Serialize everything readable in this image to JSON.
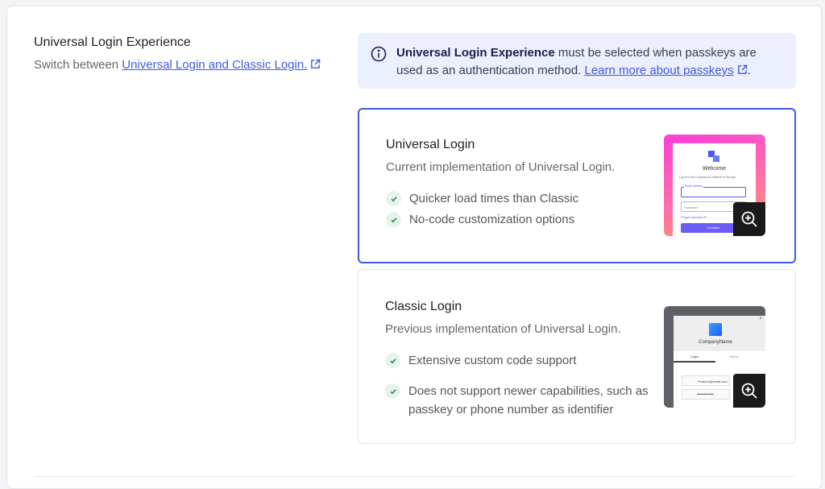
{
  "section": {
    "title": "Universal Login Experience",
    "description_prefix": "Switch between ",
    "description_link": "Universal Login and Classic Login."
  },
  "info": {
    "bold": "Universal Login Experience",
    "text": " must be selected when passkeys are used as an authentication method. ",
    "link": "Learn more about passkeys",
    "suffix": "."
  },
  "options": [
    {
      "title": "Universal Login",
      "description": "Current implementation of Universal Login.",
      "selected": true,
      "features": [
        "Quicker load times than Classic",
        "No-code customization options"
      ],
      "preview": {
        "heading": "Welcome",
        "subtext": "Log in to My Company to continue to My App.",
        "email_label": "Email address",
        "password_placeholder": "Password",
        "forgot": "Forgot password?",
        "button": "Continue"
      }
    },
    {
      "title": "Classic Login",
      "description": "Previous implementation of Universal Login.",
      "selected": false,
      "features": [
        "Extensive custom code support",
        "Does not support newer capabilities, such as passkey or phone number as identifier"
      ],
      "preview": {
        "company": "CompanyName",
        "tab_login": "Login",
        "tab_signup": "Signup",
        "email": "Featuos@email.com",
        "password_mask": "••••••••••••"
      }
    }
  ],
  "colors": {
    "accent": "#3f59e4",
    "info_bg": "#eceffd",
    "check_bg": "#e4f4ea",
    "check": "#2f8a4e"
  },
  "icons": {
    "info": "info-circle-icon",
    "external": "external-link-icon",
    "check": "check-icon",
    "zoom": "zoom-in-icon"
  }
}
